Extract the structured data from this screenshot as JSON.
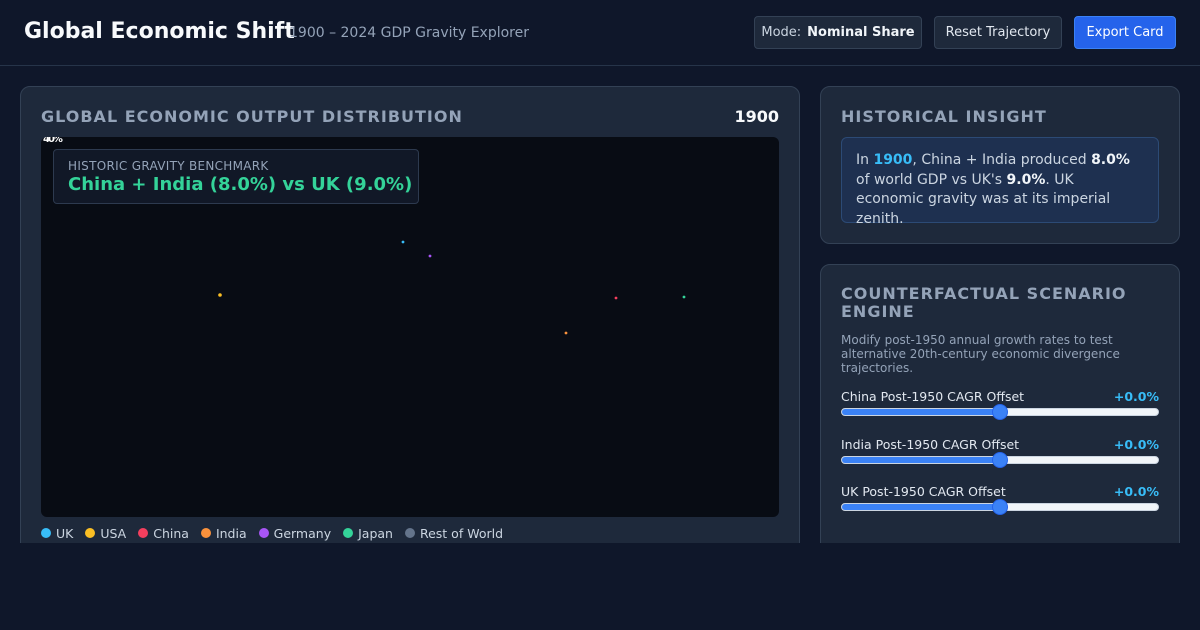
{
  "header": {
    "title": "Global Economic Shift",
    "subtitle": "1900 – 2024 GDP Gravity Explorer",
    "mode_label": "Mode:",
    "mode_value": "Nominal Share",
    "reset_label": "Reset Trajectory",
    "export_label": "Export Card"
  },
  "main": {
    "title": "Global Economic Output Distribution",
    "year": "1900",
    "axis_glitch": "40%",
    "benchmark_label": "Historic Gravity Benchmark",
    "benchmark_value": "China + India (8.0%) vs UK (9.0%)"
  },
  "legend": [
    {
      "name": "UK",
      "color": "#38bdf8"
    },
    {
      "name": "USA",
      "color": "#fbbf24"
    },
    {
      "name": "China",
      "color": "#f43f5e"
    },
    {
      "name": "India",
      "color": "#fb923c"
    },
    {
      "name": "Germany",
      "color": "#a855f7"
    },
    {
      "name": "Japan",
      "color": "#34d399"
    },
    {
      "name": "Rest of World",
      "color": "#64748b"
    }
  ],
  "insight": {
    "title": "Historical Insight",
    "t1": "In ",
    "year": "1900",
    "t2": ", China + India produced ",
    "ci": "8.0%",
    "t3": " of world GDP vs UK's ",
    "uk": "9.0%",
    "t4": ". UK economic gravity was at its imperial zenith."
  },
  "scenario": {
    "title": "Counterfactual Scenario Engine",
    "description": "Modify post-1950 annual growth rates to test alternative 20th-century economic divergence trajectories.",
    "sliders": [
      {
        "label": "China Post-1950 CAGR Offset",
        "value": "+0.0%",
        "fraction": 0.5
      },
      {
        "label": "India Post-1950 CAGR Offset",
        "value": "+0.0%",
        "fraction": 0.5
      },
      {
        "label": "UK Post-1950 CAGR Offset",
        "value": "+0.0%",
        "fraction": 0.5
      }
    ]
  }
}
